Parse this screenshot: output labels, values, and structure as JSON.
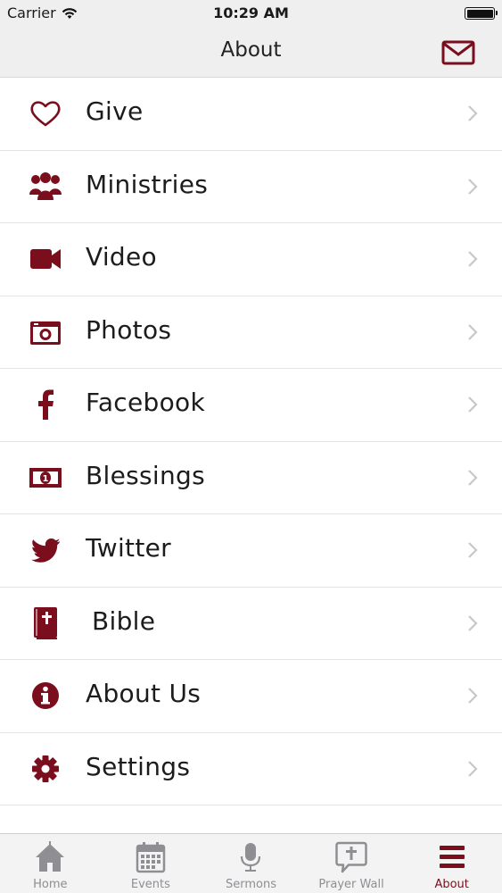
{
  "status_bar": {
    "carrier": "Carrier",
    "time": "10:29 AM"
  },
  "nav": {
    "title": "About"
  },
  "colors": {
    "accent": "#7a0e1d",
    "tab_inactive": "#8e8e93",
    "chevron": "#c7c7cc"
  },
  "menu": [
    {
      "label": "Give",
      "icon": "heart-icon"
    },
    {
      "label": "Ministries",
      "icon": "group-icon"
    },
    {
      "label": "Video",
      "icon": "video-camera-icon"
    },
    {
      "label": "Photos",
      "icon": "camera-icon"
    },
    {
      "label": "Facebook",
      "icon": "facebook-icon"
    },
    {
      "label": "Blessings",
      "icon": "money-icon"
    },
    {
      "label": "Twitter",
      "icon": "twitter-icon"
    },
    {
      "label": "Bible",
      "icon": "bible-icon"
    },
    {
      "label": "About Us",
      "icon": "info-icon"
    },
    {
      "label": "Settings",
      "icon": "gear-icon"
    }
  ],
  "tabs": [
    {
      "label": "Home",
      "icon": "home-icon",
      "active": false
    },
    {
      "label": "Events",
      "icon": "calendar-icon",
      "active": false
    },
    {
      "label": "Sermons",
      "icon": "microphone-icon",
      "active": false
    },
    {
      "label": "Prayer Wall",
      "icon": "prayer-bubble-icon",
      "active": false
    },
    {
      "label": "About",
      "icon": "menu-icon",
      "active": true
    }
  ]
}
